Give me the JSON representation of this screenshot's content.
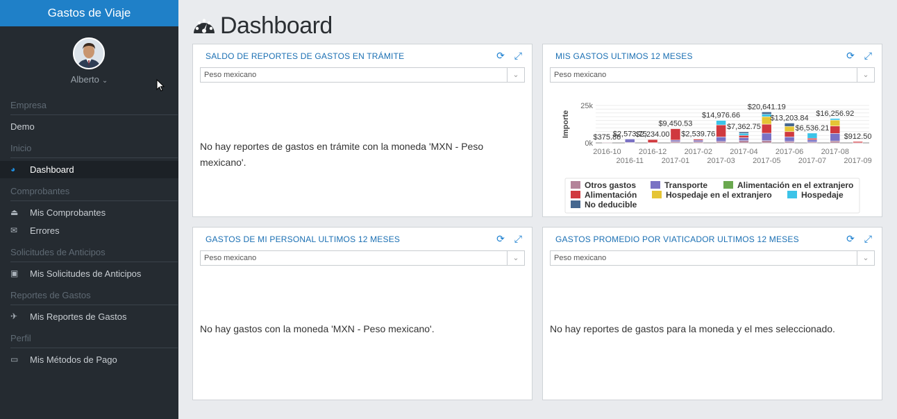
{
  "app": {
    "title": "Gastos de Viaje"
  },
  "user": {
    "name": "Alberto"
  },
  "nav": [
    {
      "type": "section",
      "label": "Empresa"
    },
    {
      "type": "item",
      "label": "Demo",
      "icon": "none"
    },
    {
      "type": "section",
      "label": "Inicio"
    },
    {
      "type": "item",
      "label": "Dashboard",
      "icon": "dashboard-icon",
      "active": true
    },
    {
      "type": "section",
      "label": "Comprobantes"
    },
    {
      "type": "item",
      "label": "Mis Comprobantes",
      "icon": "inbox-icon"
    },
    {
      "type": "item",
      "label": "Errores",
      "icon": "envelope-icon"
    },
    {
      "type": "section",
      "label": "Solicitudes de Anticipos"
    },
    {
      "type": "item",
      "label": "Mis Solicitudes de Anticipos",
      "icon": "money-icon"
    },
    {
      "type": "section",
      "label": "Reportes de Gastos"
    },
    {
      "type": "item",
      "label": "Mis Reportes de Gastos",
      "icon": "plane-icon"
    },
    {
      "type": "section",
      "label": "Perfil"
    },
    {
      "type": "item",
      "label": "Mis Métodos de Pago",
      "icon": "credit-card-icon"
    }
  ],
  "page": {
    "title": "Dashboard"
  },
  "panels": {
    "saldo": {
      "title": "SALDO DE REPORTES DE GASTOS EN TRÁMITE",
      "currency": "Peso mexicano",
      "message": "No hay reportes de gastos en trámite con la moneda 'MXN - Peso mexicano'."
    },
    "gastos": {
      "title": "MIS GASTOS ULTIMOS 12 MESES",
      "currency": "Peso mexicano"
    },
    "personal": {
      "title": "GASTOS DE MI PERSONAL ULTIMOS 12 MESES",
      "currency": "Peso mexicano",
      "message": "No hay gastos con la moneda 'MXN - Peso mexicano'."
    },
    "promedio": {
      "title": "GASTOS PROMEDIO POR VIATICADOR ULTIMOS 12 MESES",
      "currency": "Peso mexicano",
      "message": "No hay reportes de gastos para la moneda y el mes seleccionado."
    }
  },
  "chart_data": {
    "type": "bar",
    "stacked": true,
    "ylabel": "Importe",
    "yticks": [
      "0k",
      "25k"
    ],
    "ylim": [
      0,
      25000
    ],
    "categories": [
      "2016-10",
      "2016-11",
      "2016-12",
      "2017-01",
      "2017-02",
      "2017-03",
      "2017-04",
      "2017-05",
      "2017-06",
      "2017-07",
      "2017-08",
      "2017-09"
    ],
    "totals": [
      375.86,
      2573.75,
      2234.0,
      9450.53,
      2539.76,
      14976.66,
      7362.75,
      20641.19,
      13203.84,
      6536.21,
      16256.92,
      912.5
    ],
    "total_labels": [
      "$375.86",
      "$2,573.75",
      "$2,234.00",
      "$9,450.53",
      "$2,539.76",
      "$14,976.66",
      "$7,362.75",
      "$20,641.19",
      "$13,203.84",
      "$6,536.21",
      "$16,256.92",
      "$912.50"
    ],
    "series": [
      {
        "name": "Otros gastos",
        "color": "#b4849a",
        "values": [
          376,
          300,
          200,
          900,
          800,
          1000,
          1500,
          1500,
          1000,
          600,
          1300,
          100
        ]
      },
      {
        "name": "Transporte",
        "color": "#7a72c4",
        "values": [
          0,
          2274,
          0,
          1000,
          1000,
          3000,
          2000,
          5000,
          3000,
          1500,
          5000,
          0
        ]
      },
      {
        "name": "Alimentación en el extranjero",
        "color": "#6aa84f",
        "values": [
          0,
          0,
          0,
          0,
          0,
          0,
          0,
          0,
          0,
          0,
          0,
          0
        ]
      },
      {
        "name": "Alimentación",
        "color": "#d0393e",
        "values": [
          0,
          0,
          2034,
          7551,
          740,
          8000,
          1500,
          6000,
          3500,
          1000,
          5000,
          813
        ]
      },
      {
        "name": "Hospedaje en el extranjero",
        "color": "#e5c535",
        "values": [
          0,
          0,
          0,
          0,
          0,
          0,
          0,
          5000,
          3500,
          0,
          3957,
          0
        ]
      },
      {
        "name": "Hospedaje",
        "color": "#3cc3e8",
        "values": [
          0,
          0,
          0,
          0,
          0,
          2977,
          1363,
          1641,
          0,
          3436,
          1000,
          0
        ]
      },
      {
        "name": "No deducible",
        "color": "#45678f",
        "values": [
          0,
          0,
          0,
          0,
          0,
          0,
          1000,
          1500,
          2204,
          0,
          0,
          0
        ]
      }
    ]
  }
}
